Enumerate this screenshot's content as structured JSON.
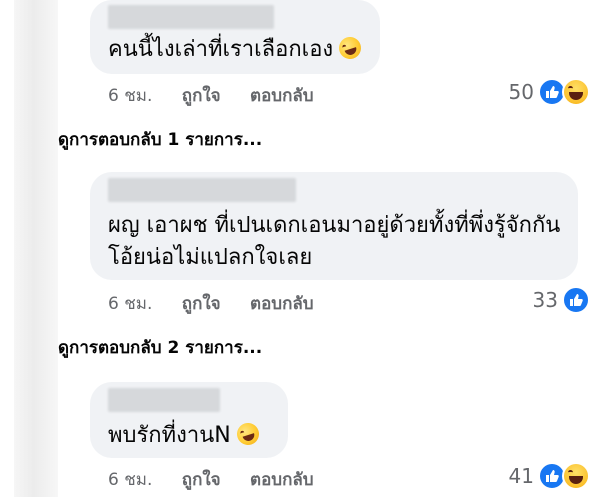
{
  "comments": [
    {
      "text_lines": [
        "คนนี้ไงเล่าที่เราเลือกเอง"
      ],
      "has_emoji": true,
      "time": "6 ชม.",
      "like_label": "ถูกใจ",
      "reply_label": "ตอบกลับ",
      "reaction_count": "50",
      "reactions": [
        "like",
        "haha"
      ]
    },
    {
      "text_lines": [
        "ผญ เอาผช ที่เปนเดกเอนมาอยู่ด้วยทั้งที่พึ่งรู้จักกัน",
        "โอ้ยน่อไม่แปลกใจเลย"
      ],
      "has_emoji": false,
      "time": "6 ชม.",
      "like_label": "ถูกใจ",
      "reply_label": "ตอบกลับ",
      "reaction_count": "33",
      "reactions": [
        "like"
      ]
    },
    {
      "text_lines": [
        "พบรักที่งานN"
      ],
      "has_emoji": true,
      "time": "6 ชม.",
      "like_label": "ถูกใจ",
      "reply_label": "ตอบกลับ",
      "reaction_count": "41",
      "reactions": [
        "like",
        "haha"
      ]
    }
  ],
  "view_replies": [
    "ดูการตอบกลับ 1 รายการ...",
    "ดูการตอบกลับ 2 รายการ..."
  ],
  "colors": {
    "bubble": "#f0f2f5",
    "meta_text": "#65676b",
    "like_blue": "#1877f2"
  },
  "icons": {
    "like": "like-reaction-icon",
    "haha": "haha-reaction-icon",
    "emoji": "rolling-on-floor-laughing-emoji-icon"
  }
}
